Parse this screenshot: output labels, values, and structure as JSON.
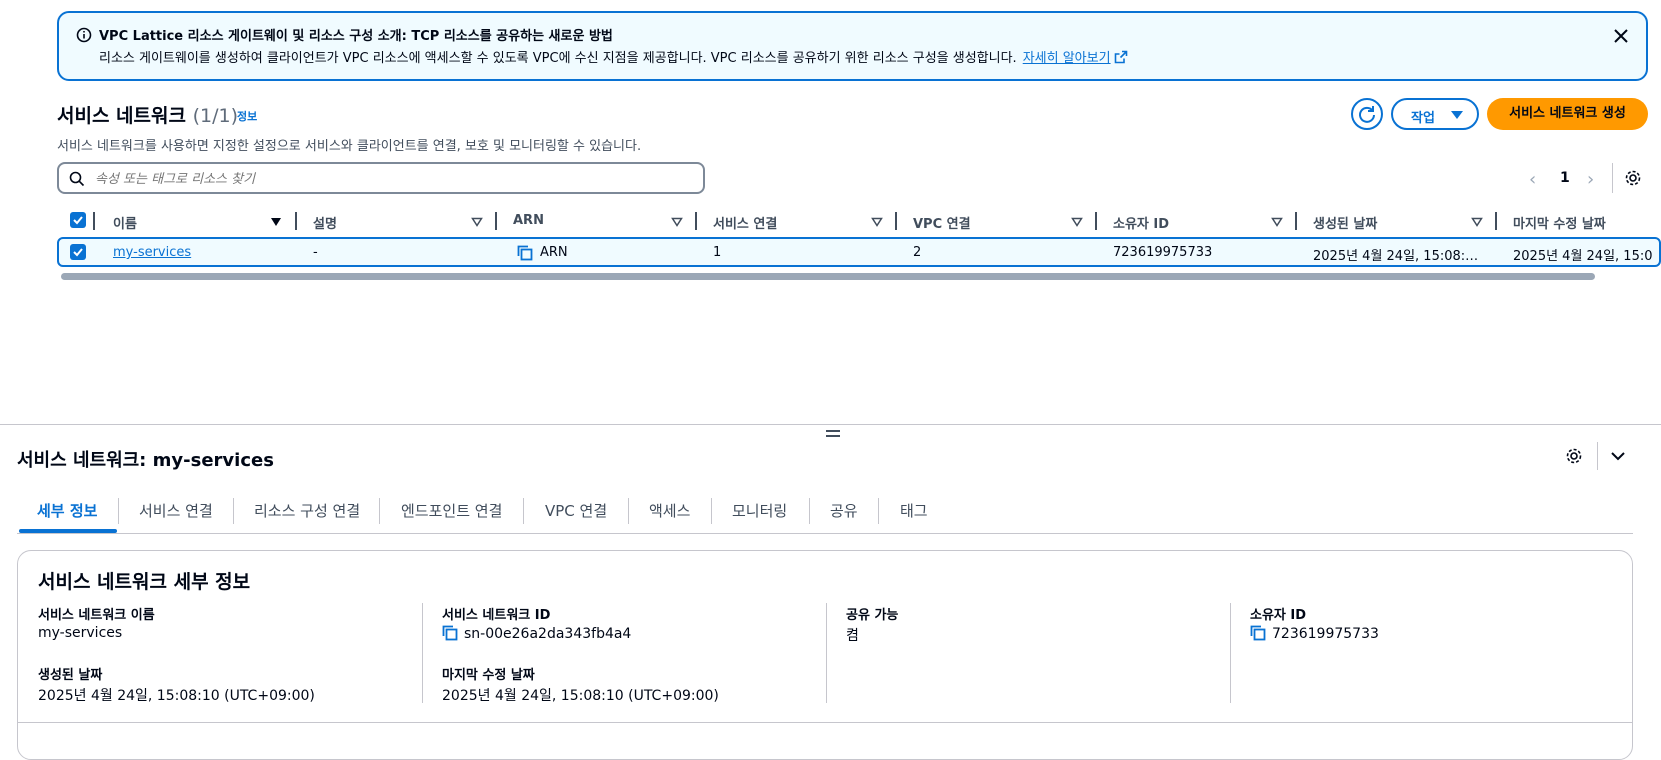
{
  "banner": {
    "title": "VPC Lattice 리소스 게이트웨이 및 리소스 구성 소개: TCP 리소스를 공유하는 새로운 방법",
    "body": "리소스 게이트웨이를 생성하여 클라이언트가 VPC 리소스에 액세스할 수 있도록 VPC에 수신 지점을 제공합니다. VPC 리소스를 공유하기 위한 리소스 구성을 생성합니다.",
    "link": "자세히 알아보기"
  },
  "header": {
    "title": "서비스 네트워크",
    "count": "(1/1)",
    "info": "정보",
    "description": "서비스 네트워크를 사용하면 지정한 설정으로 서비스와 클라이언트를 연결, 보호 및 모니터링할 수 있습니다.",
    "action_label": "작업",
    "create_label": "서비스 네트워크 생성"
  },
  "search": {
    "placeholder": "속성 또는 태그로 리소스 찾기"
  },
  "pagination": {
    "page": "1"
  },
  "table": {
    "columns": [
      "이름",
      "설명",
      "ARN",
      "서비스 연결",
      "VPC 연결",
      "소유자 ID",
      "생성된 날짜",
      "마지막 수정 날짜"
    ],
    "rows": [
      {
        "name": "my-services",
        "description": "-",
        "arn": "ARN",
        "service_assoc": "1",
        "vpc_assoc": "2",
        "owner_id": "723619975733",
        "created": "2025년 4월 24일, 15:08:…",
        "modified": "2025년 4월 24일, 15:0"
      }
    ]
  },
  "split_panel": {
    "title": "서비스 네트워크: my-services",
    "tabs": [
      "세부 정보",
      "서비스 연결",
      "리소스 구성 연결",
      "엔드포인트 연결",
      "VPC 연결",
      "액세스",
      "모니터링",
      "공유",
      "태그"
    ],
    "details": {
      "title": "서비스 네트워크 세부 정보",
      "name_label": "서비스 네트워크 이름",
      "name_value": "my-services",
      "id_label": "서비스 네트워크 ID",
      "id_value": "sn-00e26a2da343fb4a4",
      "shareable_label": "공유 가능",
      "shareable_value": "켬",
      "owner_label": "소유자 ID",
      "owner_value": "723619975733",
      "created_label": "생성된 날짜",
      "created_value": "2025년 4월 24일, 15:08:10 (UTC+09:00)",
      "modified_label": "마지막 수정 날짜",
      "modified_value": "2025년 4월 24일, 15:08:10 (UTC+09:00)"
    }
  },
  "colors": {
    "accent": "#0972d3",
    "primary_button": "#ff9900",
    "banner_bg": "#f0fbff"
  }
}
